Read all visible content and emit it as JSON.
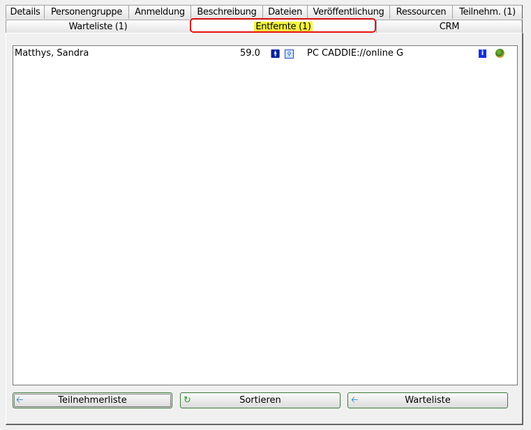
{
  "tabs_row1": [
    "Details",
    "Personengruppe",
    "Anmeldung",
    "Beschreibung",
    "Dateien",
    "Veröffentlichung",
    "Ressourcen",
    "Teilnehm. (1)"
  ],
  "tabs_row2": [
    "Warteliste (1)",
    "Entfernte (1)",
    "CRM"
  ],
  "active_tab": "Entfernte (1)",
  "list": [
    {
      "name": "Matthys, Sandra",
      "handicap": "59.0",
      "source": "PC CADDIE://online G",
      "icons": [
        "person-icon",
        "search-doc-icon",
        "info-icon",
        "golf-bag-icon"
      ]
    }
  ],
  "buttons": {
    "participants": "Teilnehmerliste",
    "sort": "Sortieren",
    "waitlist": "Warteliste"
  },
  "colors": {
    "highlight": "#f4f440",
    "annotation": "#e01010"
  }
}
